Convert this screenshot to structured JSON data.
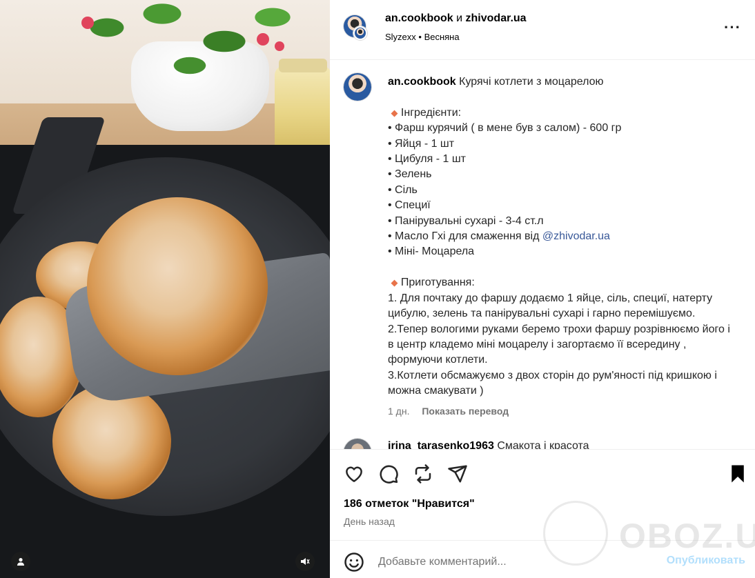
{
  "post": {
    "header": {
      "user1": "an.cookbook",
      "conj": "и",
      "user2": "zhivodar.ua",
      "audio": "Slyzexx • Весняна"
    },
    "caption": {
      "user": "an.cookbook",
      "title": "Курячі котлети з моцарелою",
      "ingredients_header": "Інгредієнти:",
      "ingredients": [
        "• Фарш курячий ( в мене був з салом) - 600 гр",
        "• Яйця - 1 шт",
        "• Цибуля - 1 шт",
        "• Зелень",
        "• Сіль",
        "• Специї",
        "• Панірувальні сухарі - 3-4 ст.л"
      ],
      "butter_line": "• Масло Гхі для смаження від ",
      "mention": "@zhivodar.ua",
      "last_ingredient": "• Міні- Моцарела",
      "steps_header": "Приготування:",
      "steps": [
        "1. Для почтаку до фаршу додаємо 1 яйце, сіль, специї, натерту цибулю, зелень та панірувальні сухарі і гарно перемішуємо.",
        "2.Тепер вологими руками беремо трохи фаршу розрівнюємо його і в центр кладемо міні моцарелу і загортаємо її всередину , формуючи котлети.",
        "3.Котлети обсмажуємо з двох сторін до рум'яності під кришкою і можна смакувати )"
      ],
      "time": "1 дн.",
      "translate": "Показать перевод"
    },
    "comment": {
      "user": "irina_tarasenko1963",
      "text": "Смакота і красота"
    },
    "likes": "186 отметок \"Нравится\"",
    "date": "День назад",
    "comment_placeholder": "Добавьте комментарий...",
    "post_button": "Опубликовать",
    "watermark": "OBOZ.UA"
  },
  "icons": [
    "heart-icon",
    "comment-icon",
    "repost-icon",
    "share-icon",
    "bookmark-icon",
    "emoji-icon",
    "more-icon",
    "user-tag-icon",
    "mute-icon"
  ]
}
